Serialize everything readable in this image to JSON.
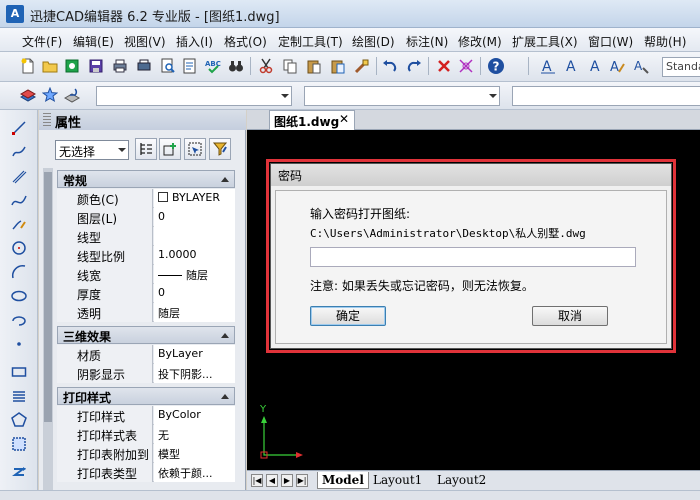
{
  "window": {
    "title": "迅捷CAD编辑器 6.2 专业版  - [图纸1.dwg]",
    "icon_letter": "A",
    "accent": "#1f63b5"
  },
  "menu": [
    "文件(F)",
    "编辑(E)",
    "视图(V)",
    "插入(I)",
    "格式(O)",
    "定制工具(T)",
    "绘图(D)",
    "标注(N)",
    "修改(M)",
    "扩展工具(X)",
    "窗口(W)",
    "帮助(H)"
  ],
  "toolbar": {
    "style_combo_value": "Standa"
  },
  "properties": {
    "title": "属性",
    "selection": "无选择",
    "sections": [
      {
        "label": "常规",
        "rows": [
          {
            "key": "颜色(C)",
            "value": "BYLAYER"
          },
          {
            "key": "图层(L)",
            "value": "0"
          },
          {
            "key": "线型",
            "value": ""
          },
          {
            "key": "线型比例",
            "value": "1.0000"
          },
          {
            "key": "线宽",
            "value": "随层"
          },
          {
            "key": "厚度",
            "value": "0"
          },
          {
            "key": "透明",
            "value": "随层"
          }
        ]
      },
      {
        "label": "三维效果",
        "rows": [
          {
            "key": "材质",
            "value": "ByLayer"
          },
          {
            "key": "阴影显示",
            "value": "投下阴影..."
          }
        ]
      },
      {
        "label": "打印样式",
        "rows": [
          {
            "key": "打印样式",
            "value": "ByColor"
          },
          {
            "key": "打印样式表",
            "value": "无"
          },
          {
            "key": "打印表附加到",
            "value": "模型"
          },
          {
            "key": "打印表类型",
            "value": "依赖于颜..."
          }
        ]
      }
    ]
  },
  "document": {
    "tab_label": "图纸1.dwg",
    "close_glyph": "✕"
  },
  "layout_tabs": [
    "Model",
    "Layout1",
    "Layout2"
  ],
  "canvas": {
    "y_axis_label": "Y",
    "background": "#000000",
    "axis_color": "#3ad13a"
  },
  "dialog": {
    "title": "密码",
    "prompt": "输入密码打开图纸:",
    "path": "C:\\Users\\Administrator\\Desktop\\私人别墅.dwg",
    "password_value": "",
    "note": "注意: 如果丢失或忘记密码，则无法恢复。",
    "ok_label": "确定",
    "cancel_label": "取消",
    "highlight_color": "#e0333a"
  }
}
